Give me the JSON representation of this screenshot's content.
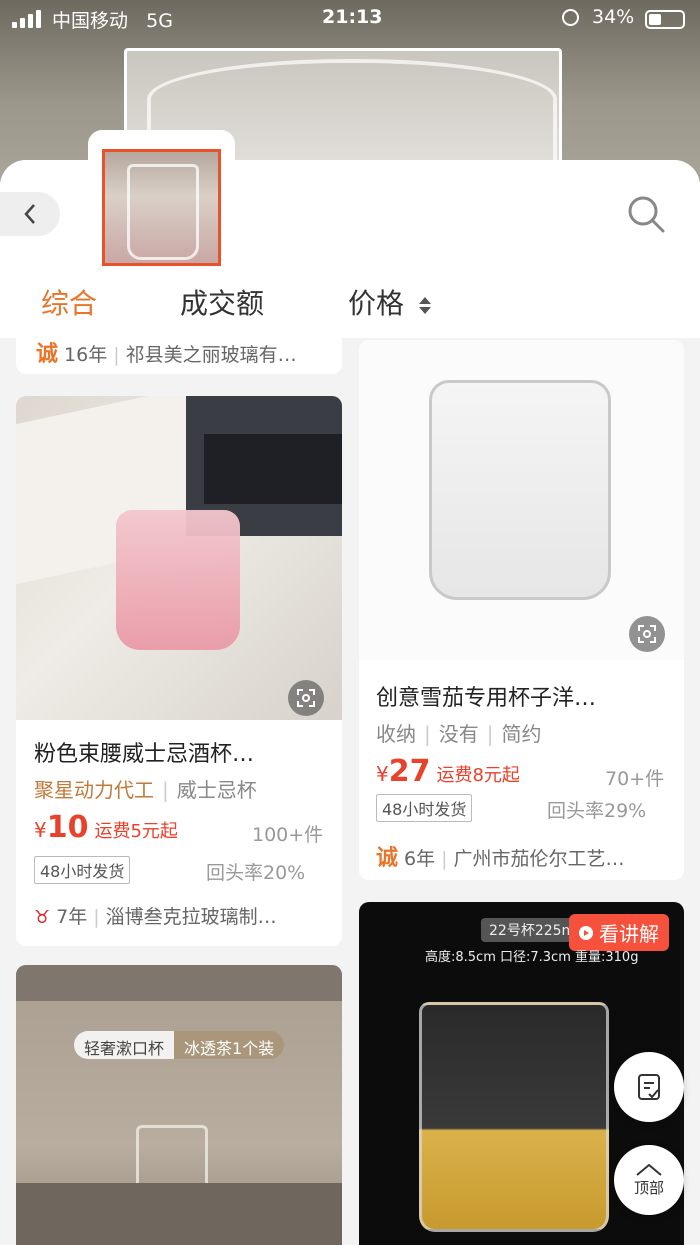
{
  "status_bar": {
    "carrier": "中国移动",
    "network": "5G",
    "time": "21:13",
    "battery": "34%"
  },
  "tabs": [
    {
      "label": "综合",
      "active": true
    },
    {
      "label": "成交额",
      "active": false
    },
    {
      "label": "价格",
      "active": false
    }
  ],
  "top_partial": {
    "shop_years": "16年",
    "shop_name": "祁县美之丽玻璃有…"
  },
  "products": [
    {
      "title": "粉色束腰威士忌酒杯…",
      "tags": [
        "聚星动力代工",
        "威士忌杯"
      ],
      "price": "10",
      "shipping": "运费5元起",
      "sold": "100+件",
      "badge": "48小时发货",
      "repeat_rate": "回头率20%",
      "shop_years": "7年",
      "shop_name": "淄博叁克拉玻璃制…"
    },
    {
      "title": "创意雪茄专用杯子洋…",
      "tags": [
        "收纳",
        "没有",
        "简约"
      ],
      "price": "27",
      "shipping": "运费8元起",
      "sold": "70+件",
      "badge": "48小时发货",
      "repeat_rate": "回头率29%",
      "shop_years": "6年",
      "shop_name": "广州市茄伦尔工艺…"
    }
  ],
  "bottom_left": {
    "label_a": "轻奢漱口杯",
    "label_b": "冰透茶1个装"
  },
  "bottom_right": {
    "cup_label": "22号杯225ml",
    "live_label": "看讲解",
    "specs": "高度:8.5cm 口径:7.3cm 重量:310g"
  },
  "currency": "¥",
  "float_buttons": {
    "top_label": "顶部"
  },
  "colors": {
    "accent": "#e8762a",
    "price": "#e8412c"
  }
}
